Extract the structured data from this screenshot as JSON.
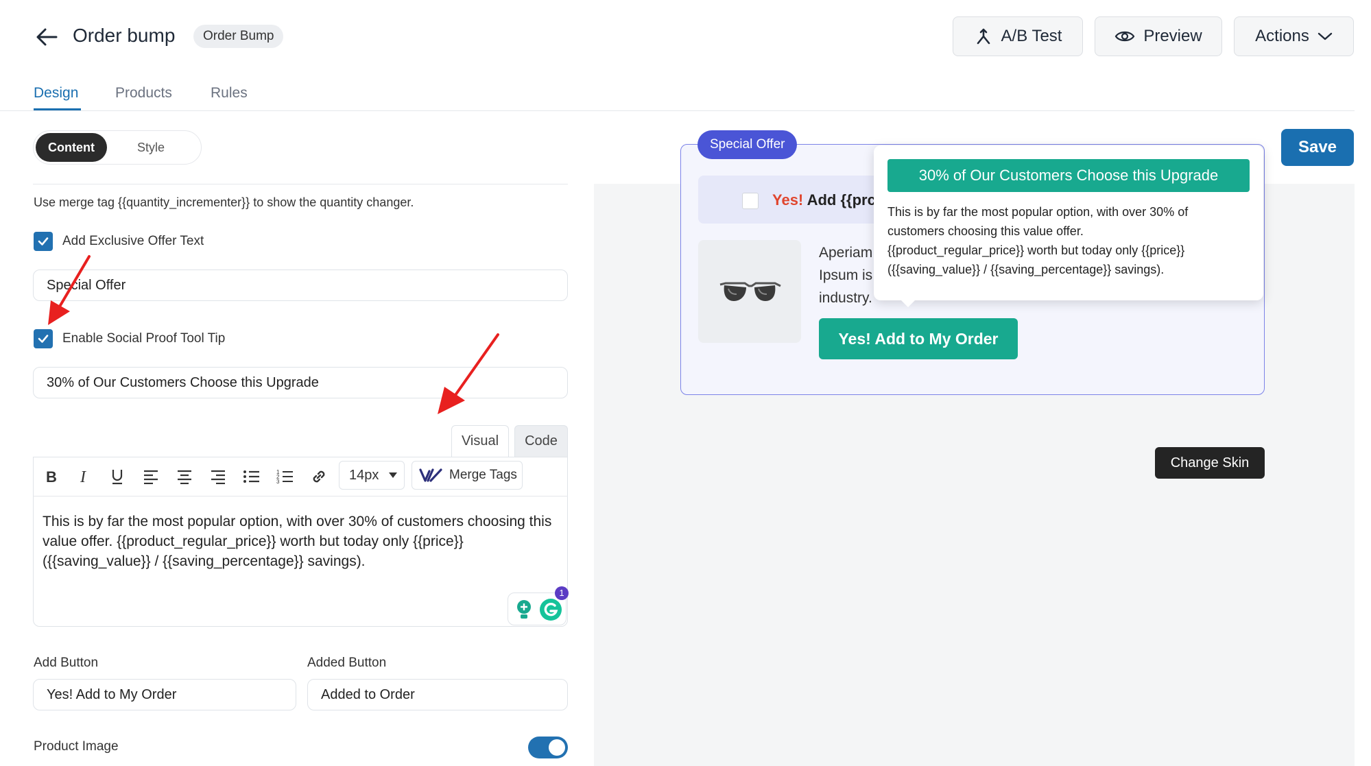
{
  "header": {
    "title": "Order bump",
    "type_badge": "Order Bump",
    "ab_test_label": "A/B Test",
    "preview_label": "Preview",
    "actions_label": "Actions"
  },
  "tabs": [
    {
      "label": "Design",
      "active": true
    },
    {
      "label": "Products",
      "active": false
    },
    {
      "label": "Rules",
      "active": false
    }
  ],
  "segmented": {
    "content": "Content",
    "style": "Style"
  },
  "form": {
    "help_text": "Use merge tag {{quantity_incrementer}} to show the quantity changer.",
    "exclusive_offer_label": "Add Exclusive Offer Text",
    "exclusive_offer_value": "Special Offer",
    "social_proof_label": "Enable Social Proof Tool Tip",
    "social_proof_value": "30% of Our Customers Choose this Upgrade",
    "editor": {
      "tab_visual": "Visual",
      "tab_code": "Code",
      "font_size": "14px",
      "merge_tags_label": "Merge Tags",
      "content": "This is by far the most popular option, with over 30% of customers choosing this value offer. {{product_regular_price}} worth but today only {{price}} ({{saving_value}} / {{saving_percentage}} savings).",
      "grammarly_count": "1"
    },
    "add_button_label": "Add Button",
    "add_button_value": "Yes! Add to My Order",
    "added_button_label": "Added Button",
    "added_button_value": "Added to Order",
    "product_image_label": "Product Image",
    "product_image_on": true
  },
  "preview": {
    "save_label": "Save",
    "offer_badge": "Special Offer",
    "bump_title_yes": "Yes!",
    "bump_title_rest": "Add {{prc",
    "product_desc_lines": [
      "Aperiam",
      "Ipsum is",
      "industry."
    ],
    "add_button": "Yes! Add to My Order",
    "tooltip_title": "30% of Our Customers Choose this Upgrade",
    "tooltip_lines": [
      "This is by far the most popular option, with over 30% of",
      "customers choosing this value offer.",
      "{{product_regular_price}} worth but today only {{price}}",
      "({{saving_value}} / {{saving_percentage}} savings)."
    ],
    "change_skin_label": "Change Skin"
  },
  "colors": {
    "primary": "#2271b1",
    "accent_green": "#18a98f",
    "badge_blue": "#4a55d6",
    "annotation_red": "#e8201f"
  }
}
